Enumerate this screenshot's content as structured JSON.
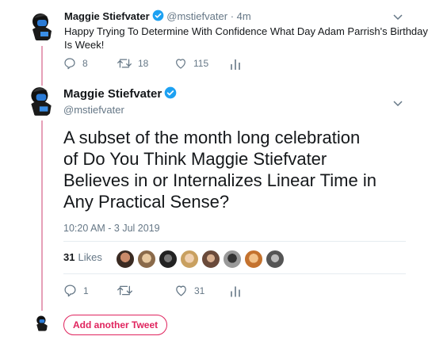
{
  "tweet1": {
    "name": "Maggie Stiefvater",
    "handle": "@mstiefvater",
    "time": "· 4m",
    "text_line1": "Happy Trying To Determine With Confidence What Day Adam Parrish's Birthday",
    "text_line2": "Is Week!",
    "replies": "8",
    "retweets": "18",
    "likes": "115"
  },
  "tweet2": {
    "name": "Maggie Stiefvater",
    "handle": "@mstiefvater",
    "text_lines": [
      "A subset of the month long celebration",
      "of Do You Think Maggie Stiefvater",
      "Believes in or Internalizes Linear Time in",
      "Any Practical Sense?"
    ],
    "timestamp": "10:20 AM - 3 Jul 2019",
    "likes_count": "31",
    "likes_label": "Likes",
    "replies": "1",
    "retweets": "",
    "likes": "31"
  },
  "add_tweet_label": "Add another Tweet",
  "colors": {
    "verified": "#1da1f2",
    "thread_line": "#e6a0b8",
    "add_button": "#e0245e"
  }
}
